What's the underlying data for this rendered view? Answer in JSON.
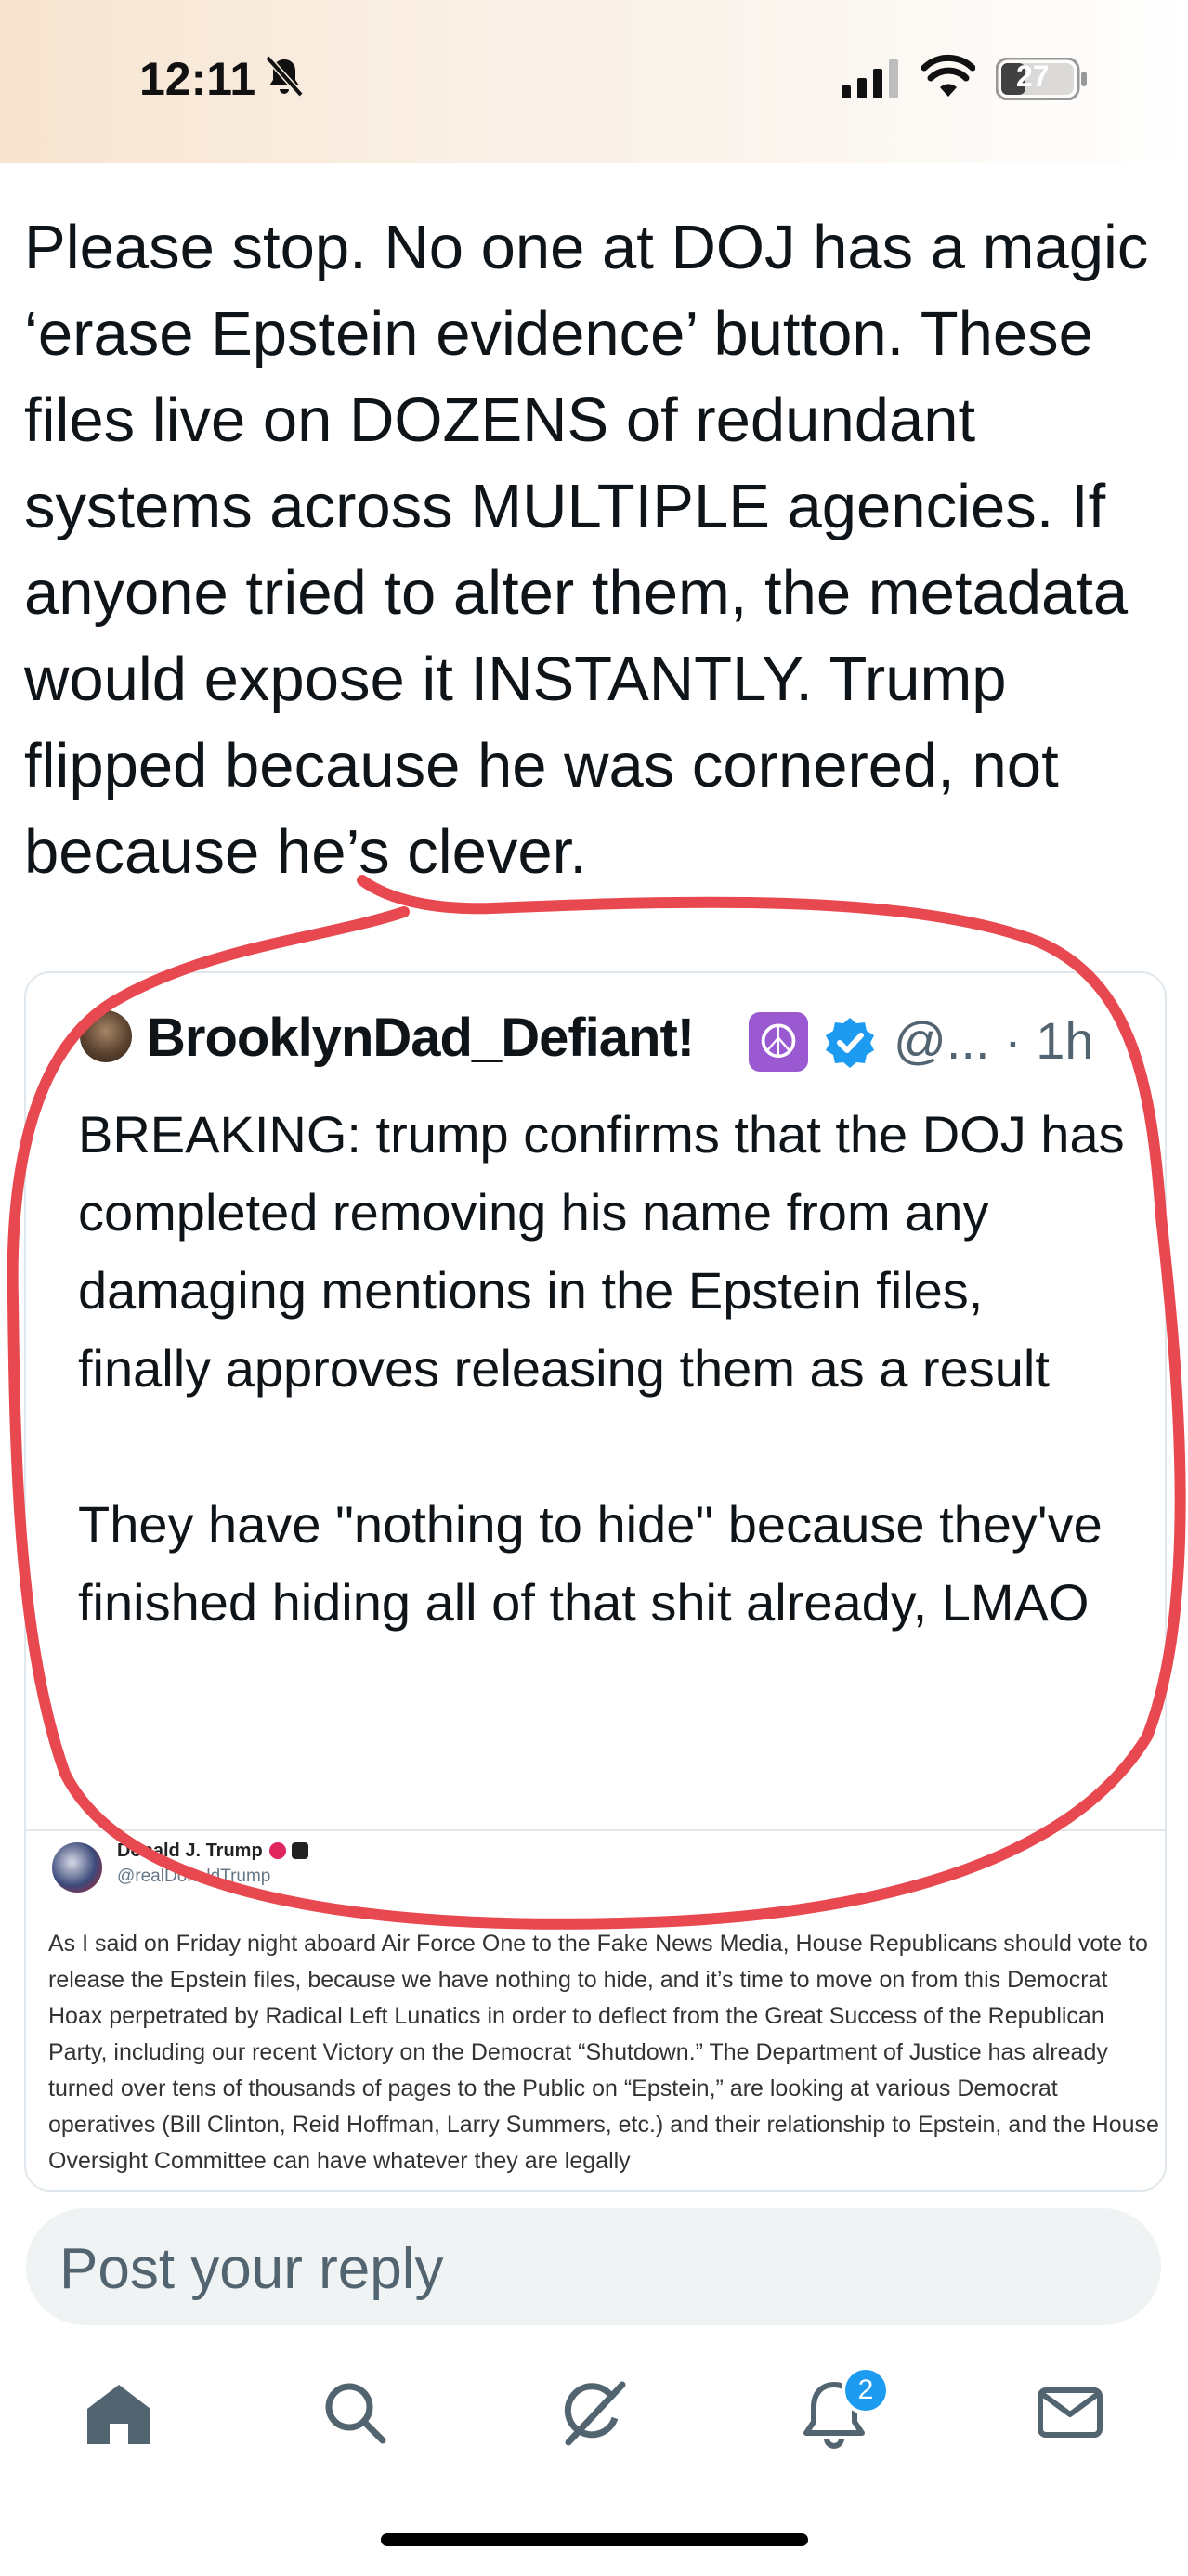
{
  "status_bar": {
    "time": "12:11",
    "battery": "27"
  },
  "post": {
    "text": "Please stop. No one at DOJ has a magic ‘erase Epstein evidence’ button. These files live on DOZENS of redundant systems across MULTIPLE agencies. If anyone tried to alter them, the metadata would expose it INSTANTLY. Trump flipped because he was cornered, not because he’s clever."
  },
  "quote": {
    "name": "BrooklynDad_Defiant!",
    "handle_time": "@... · 1h",
    "text": "BREAKING: trump confirms that the DOJ has completed removing his name from any damaging mentions in the Epstein files, finally approves releasing them as a result\n\nThey have \"nothing to hide\" because they've finished hiding all of that shit already, LMAO",
    "embedded": {
      "name": "Donald J. Trump",
      "handle": "@realDonaldTrump",
      "text": "As I said on Friday night aboard Air Force One to the Fake News Media, House Republicans should vote to release the Epstein files, because we have nothing to hide, and it’s time to move on from this Democrat Hoax perpetrated by Radical Left Lunatics in order to deflect from the Great Success of the Republican Party, including our recent Victory on the Democrat “Shutdown.” The Department of Justice has already turned over tens of thousands of pages to the Public on “Epstein,” are looking at various Democrat operatives (Bill Clinton, Reid Hoffman, Larry Summers, etc.) and their relationship to Epstein, and the House Oversight Committee can have whatever they are legally"
    }
  },
  "reply": {
    "placeholder": "Post your reply"
  },
  "tab_bar": {
    "tabs": [
      "home-icon",
      "search-icon",
      "grok-icon",
      "notifications-icon",
      "messages-icon"
    ],
    "notification_count": "2"
  },
  "colors": {
    "accent": "#1d9bf0",
    "annotation_red": "#e8484f",
    "peace_purple": "#9a59d1"
  }
}
